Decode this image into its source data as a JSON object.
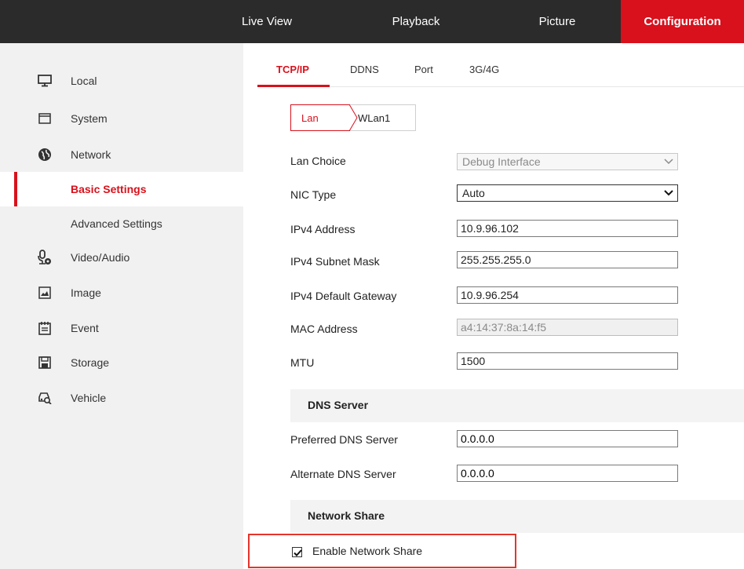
{
  "topnav": {
    "live_view": "Live View",
    "playback": "Playback",
    "picture": "Picture",
    "configuration": "Configuration"
  },
  "sidebar": {
    "items": [
      {
        "label": "Local",
        "icon": "monitor-icon"
      },
      {
        "label": "System",
        "icon": "window-icon"
      },
      {
        "label": "Network",
        "icon": "globe-icon"
      },
      {
        "label": "Basic Settings",
        "active": true
      },
      {
        "label": "Advanced Settings"
      },
      {
        "label": "Video/Audio",
        "icon": "microphone-camera-icon"
      },
      {
        "label": "Image",
        "icon": "image-icon"
      },
      {
        "label": "Event",
        "icon": "calendar-icon"
      },
      {
        "label": "Storage",
        "icon": "floppy-disk-icon"
      },
      {
        "label": "Vehicle",
        "icon": "vehicle-search-icon"
      }
    ]
  },
  "tabs": {
    "tcpip": "TCP/IP",
    "ddns": "DDNS",
    "port": "Port",
    "g34": "3G/4G"
  },
  "subtabs": {
    "lan": "Lan",
    "wlan": "WLan1"
  },
  "form": {
    "lan_choice": {
      "label": "Lan Choice",
      "value": "Debug Interface"
    },
    "nic_type": {
      "label": "NIC Type",
      "value": "Auto"
    },
    "ipv4_address": {
      "label": "IPv4 Address",
      "value": "10.9.96.102"
    },
    "ipv4_subnet": {
      "label": "IPv4 Subnet Mask",
      "value": "255.255.255.0"
    },
    "ipv4_gateway": {
      "label": "IPv4 Default Gateway",
      "value": "10.9.96.254"
    },
    "mac_address": {
      "label": "MAC Address",
      "value": "a4:14:37:8a:14:f5"
    },
    "mtu": {
      "label": "MTU",
      "value": "1500"
    }
  },
  "dns": {
    "title": "DNS Server",
    "preferred": {
      "label": "Preferred DNS Server",
      "value": "0.0.0.0"
    },
    "alternate": {
      "label": "Alternate DNS Server",
      "value": "0.0.0.0"
    }
  },
  "network_share": {
    "title": "Network Share",
    "enable_label": "Enable Network Share",
    "enabled": true
  },
  "colors": {
    "accent": "#d8111c",
    "topbar": "#2b2b2b",
    "sidebar": "#f1f1f1",
    "highlight": "#e5342b"
  }
}
